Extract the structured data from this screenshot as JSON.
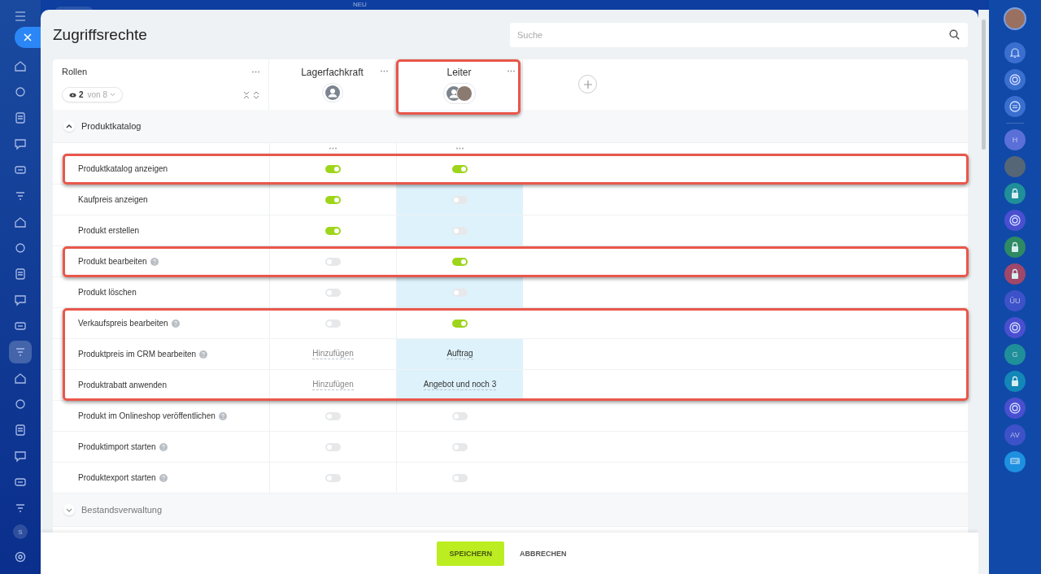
{
  "top_badge": "NEU",
  "left_nav": [
    {
      "selected": false
    },
    {
      "selected": false
    },
    {
      "selected": false
    },
    {
      "selected": false
    },
    {
      "selected": false
    },
    {
      "selected": false
    },
    {
      "selected": false
    },
    {
      "selected": false
    },
    {
      "selected": false
    },
    {
      "selected": false
    },
    {
      "selected": false
    },
    {
      "selected": true
    },
    {
      "selected": false
    },
    {
      "selected": false
    },
    {
      "selected": false
    },
    {
      "selected": false
    },
    {
      "selected": false
    },
    {
      "selected": false
    }
  ],
  "left_user": "S",
  "title": "Zugriffsrechte",
  "search": {
    "placeholder": "Suche"
  },
  "roles_header": {
    "label": "Rollen",
    "visible_count": "2",
    "of_total": "von 8"
  },
  "columns": [
    {
      "name": "Lagerfachkraft",
      "avatars": [
        {
          "kind": "placeholder"
        }
      ],
      "outlined": false
    },
    {
      "name": "Leiter",
      "avatars": [
        {
          "kind": "placeholder"
        },
        {
          "kind": "photo"
        }
      ],
      "outlined": true
    }
  ],
  "sections": [
    {
      "title": "Produktkatalog",
      "expanded": true,
      "rows": [
        {
          "label": "Produktkatalog anzeigen",
          "help": false,
          "outlined": true,
          "cells": [
            {
              "kind": "toggle",
              "on": true,
              "highlighted": false
            },
            {
              "kind": "toggle",
              "on": true,
              "highlighted": false
            }
          ]
        },
        {
          "label": "Kaufpreis anzeigen",
          "help": false,
          "outlined": false,
          "cells": [
            {
              "kind": "toggle",
              "on": true,
              "highlighted": false
            },
            {
              "kind": "toggle",
              "on": false,
              "highlighted": true
            }
          ]
        },
        {
          "label": "Produkt erstellen",
          "help": false,
          "outlined": false,
          "cells": [
            {
              "kind": "toggle",
              "on": true,
              "highlighted": false
            },
            {
              "kind": "toggle",
              "on": false,
              "highlighted": true
            }
          ]
        },
        {
          "label": "Produkt bearbeiten",
          "help": true,
          "outlined": true,
          "cells": [
            {
              "kind": "toggle",
              "on": false,
              "highlighted": false
            },
            {
              "kind": "toggle",
              "on": true,
              "highlighted": false
            }
          ]
        },
        {
          "label": "Produkt löschen",
          "help": false,
          "outlined": false,
          "cells": [
            {
              "kind": "toggle",
              "on": false,
              "highlighted": false
            },
            {
              "kind": "toggle",
              "on": false,
              "highlighted": true
            }
          ]
        },
        {
          "label": "Verkaufspreis bearbeiten",
          "help": true,
          "outlined": true,
          "cells": [
            {
              "kind": "toggle",
              "on": false,
              "highlighted": false
            },
            {
              "kind": "toggle",
              "on": true,
              "highlighted": false
            }
          ]
        },
        {
          "label": "Produktpreis im CRM bearbeiten",
          "help": true,
          "outlined": true,
          "cells": [
            {
              "kind": "add",
              "text": "Hinzufügen",
              "highlighted": false
            },
            {
              "kind": "value",
              "text": "Auftrag",
              "highlighted": true
            }
          ]
        },
        {
          "label": "Produktrabatt anwenden",
          "help": false,
          "outlined": true,
          "cells": [
            {
              "kind": "add",
              "text": "Hinzufügen",
              "highlighted": false
            },
            {
              "kind": "value",
              "text": "Angebot und noch 3",
              "highlighted": true
            }
          ]
        },
        {
          "label": "Produkt im Onlineshop veröffentlichen",
          "help": true,
          "outlined": false,
          "cells": [
            {
              "kind": "toggle",
              "on": false,
              "highlighted": false
            },
            {
              "kind": "toggle",
              "on": false,
              "highlighted": false
            }
          ]
        },
        {
          "label": "Produktimport starten",
          "help": true,
          "outlined": false,
          "cells": [
            {
              "kind": "toggle",
              "on": false,
              "highlighted": false
            },
            {
              "kind": "toggle",
              "on": false,
              "highlighted": false
            }
          ]
        },
        {
          "label": "Produktexport starten",
          "help": true,
          "outlined": false,
          "cells": [
            {
              "kind": "toggle",
              "on": false,
              "highlighted": false
            },
            {
              "kind": "toggle",
              "on": false,
              "highlighted": false
            }
          ]
        }
      ]
    },
    {
      "title": "Bestandsverwaltung",
      "expanded": false
    }
  ],
  "buttons": {
    "save": "SPEICHERN",
    "cancel": "ABBRECHEN"
  },
  "right_nav": [
    {
      "kind": "bell",
      "color": "#3a6fd0"
    },
    {
      "kind": "swirl",
      "color": "#3a6fd0"
    },
    {
      "kind": "chat",
      "color": "#3a6fd0"
    },
    {
      "kind": "letter",
      "text": "H",
      "color": "#5b6fd8"
    },
    {
      "kind": "photo",
      "color": "#556677"
    },
    {
      "kind": "lock",
      "color": "#1f8f9a"
    },
    {
      "kind": "swirl",
      "color": "#4a4fd0"
    },
    {
      "kind": "lock",
      "color": "#2e8a63"
    },
    {
      "kind": "lock",
      "color": "#a0476a"
    },
    {
      "kind": "letter",
      "text": "ÜU",
      "color": "#3d52c8"
    },
    {
      "kind": "swirl",
      "color": "#4a4fd0"
    },
    {
      "kind": "letter",
      "text": "G",
      "color": "#1f8f9a"
    },
    {
      "kind": "lock",
      "color": "#1287b8"
    },
    {
      "kind": "swirl",
      "color": "#4a4fd0"
    },
    {
      "kind": "letter",
      "text": "AV",
      "color": "#3d52c8"
    },
    {
      "kind": "openchat",
      "color": "#1e90e0"
    }
  ]
}
